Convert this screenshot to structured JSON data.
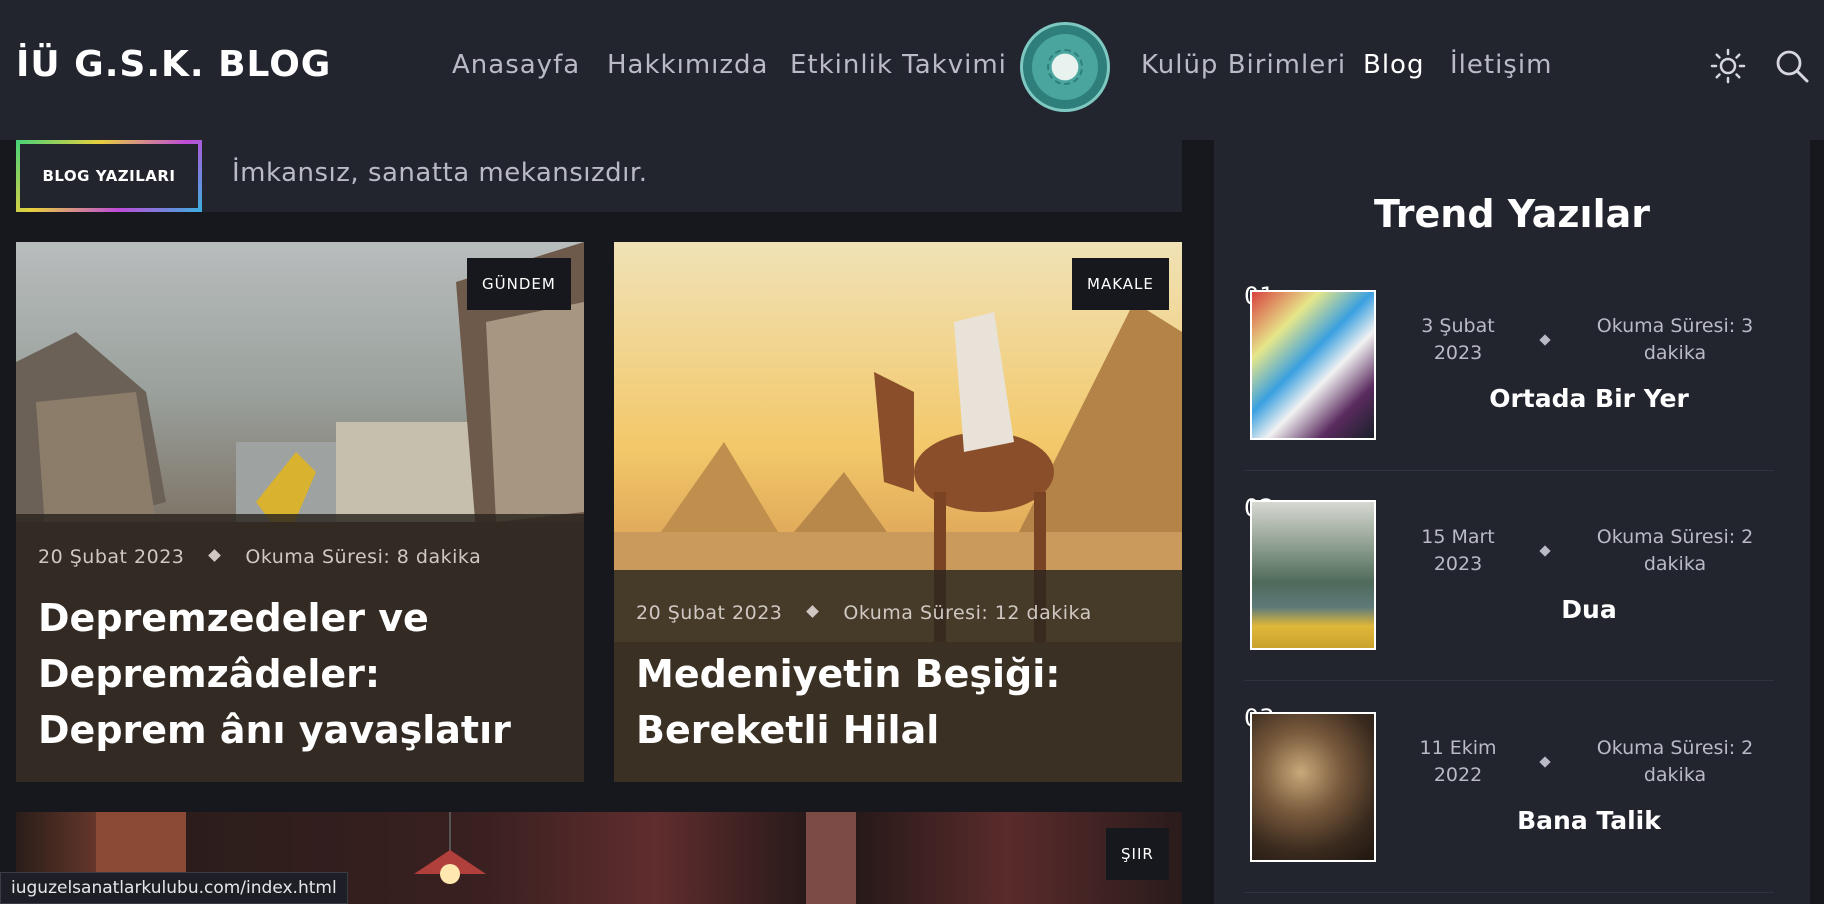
{
  "header": {
    "logo": "İÜ G.S.K. BLOG",
    "nav": [
      "Anasayfa",
      "Hakkımızda",
      "Etkinlik Takvimi",
      "Kulüp Birimleri",
      "Blog",
      "İletişim"
    ],
    "active_nav": "Blog",
    "icons": [
      "sun-icon",
      "search-icon"
    ]
  },
  "blog_bar": {
    "badge": "BLOG YAZILARI",
    "tagline": "İmkansız, sanatta mekansızdır."
  },
  "posts": [
    {
      "category": "GÜNDEM",
      "date": "20 Şubat 2023",
      "reading": "Okuma Süresi: 8 dakika",
      "title": "Depremzedeler ve Depremzâdeler: Deprem ânı yavaşlatır"
    },
    {
      "category": "MAKALE",
      "date": "20 Şubat 2023",
      "reading": "Okuma Süresi: 12 dakika",
      "title": "Medeniyetin Beşiği: Bereketli Hilal"
    },
    {
      "category": "ŞIIR"
    }
  ],
  "sidebar": {
    "title": "Trend Yazılar",
    "items": [
      {
        "num": "01",
        "date": "3 Şubat 2023",
        "reading": "Okuma Süresi: 3 dakika",
        "title": "Ortada Bir Yer"
      },
      {
        "num": "02",
        "date": "15 Mart 2023",
        "reading": "Okuma Süresi: 2 dakika",
        "title": "Dua"
      },
      {
        "num": "03",
        "date": "11 Ekim 2022",
        "reading": "Okuma Süresi: 2 dakika",
        "title": "Bana Talik"
      }
    ]
  },
  "status_bar": {
    "url": "iuguzelsanatlarkulubu.com/index.html"
  },
  "colors": {
    "header_bg": "#22242e",
    "page_bg": "#17181d",
    "text_muted": "#b9bac6"
  }
}
